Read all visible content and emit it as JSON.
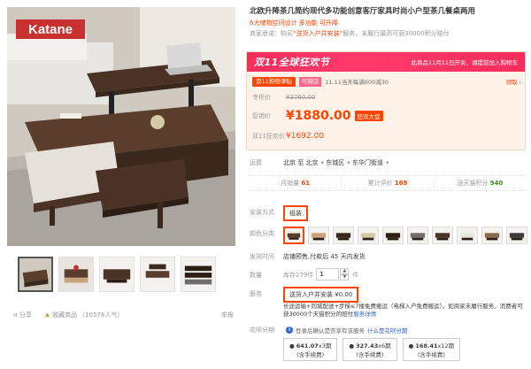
{
  "brand": {
    "logo_text": "Katane",
    "logo_bg": "#c8312f"
  },
  "product": {
    "title": "北欧升降茶几简约现代多功能创意客厅家具时尚小户型茶几餐桌两用",
    "subtitle": "6大储物空间设计  多功能  可升降",
    "promise_prefix": "商家承诺：购买",
    "promise_highlight": "“送货入户并安装”",
    "promise_suffix": "服务，未履行最高可获30000积分赔付"
  },
  "banner": {
    "text": "双11全球狂欢节",
    "note": "此商品11月11日开卖，请提前加入购物车"
  },
  "activity": {
    "tag1": "双11购物津贴",
    "tag2": "可跨店",
    "text": "11.11当天每满600减30",
    "get_label": "领取"
  },
  "prices": {
    "original_label": "专柜价",
    "original": "¥3760.00",
    "sale_label": "促销价",
    "sale": "¥1880.00",
    "sale_tag": "狂欢大促",
    "d11_label": "双11狂欢价",
    "d11": "¥1692.00"
  },
  "shipping": {
    "label": "运费",
    "from": "北京",
    "to_word": "至",
    "to": "北京",
    "district": "东城区",
    "street": "东华门街道"
  },
  "stats": {
    "monthly_label": "月销量",
    "monthly": "61",
    "reviews_label": "累计评价",
    "reviews": "169",
    "points_label": "送天猫积分",
    "points": "940"
  },
  "options": {
    "install_label": "安装方式",
    "install_value": "组装",
    "color_label": "颜色分类",
    "color_count": 11,
    "ship_time_label": "发货时间",
    "ship_time": "店铺预售,付款后 45 天内发货",
    "qty_label": "数量",
    "qty_value": "1",
    "stock_prefix": "库存279件",
    "qty_unit": "件",
    "service_label": "服务",
    "service_value": "送货入户并安装  ¥0.00"
  },
  "service_desc": {
    "text": "长途运输+同城配送+步梯≤7楼免费搬运（电梯入户免费搬运）。如商家未履行服务，消费者可获30000个天猫积分的赔付",
    "link": "服务详情"
  },
  "installment": {
    "label": "花呗分期",
    "tip": "登录后确认是否享有该服务",
    "tip_link": "什么是花呗分期",
    "plans": [
      {
        "amount": "641.07",
        "term": "x3期",
        "fee": "(含手续费)"
      },
      {
        "amount": "327.43",
        "term": "x6期",
        "fee": "(含手续费)"
      },
      {
        "amount": "168.41",
        "term": "x12期",
        "fee": "(含手续费)"
      }
    ]
  },
  "social": {
    "share": "分享",
    "favorite": "收藏商品",
    "popularity": "（10578人气）",
    "report": "举报"
  }
}
